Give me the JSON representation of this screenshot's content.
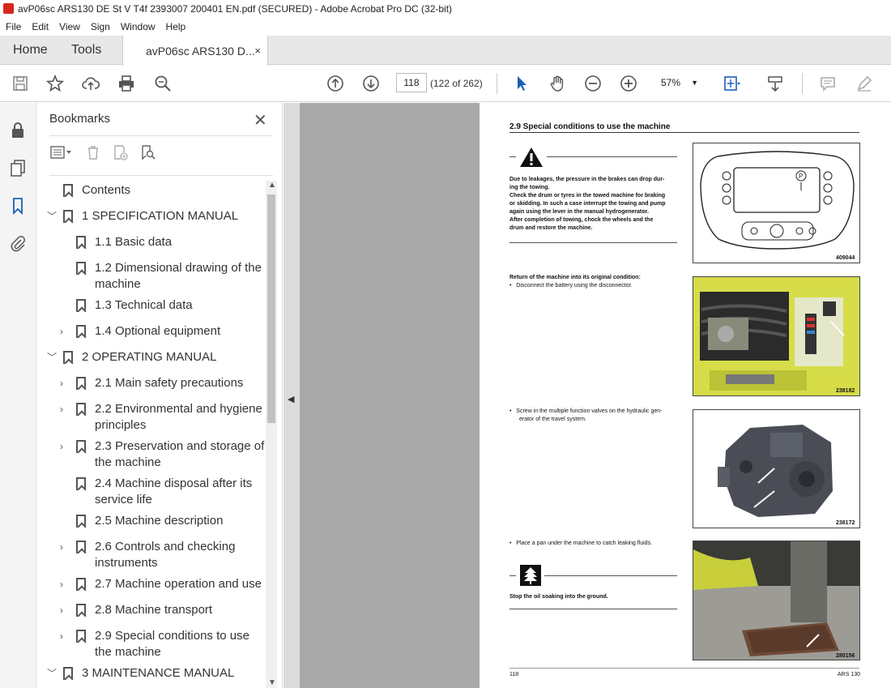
{
  "window": {
    "title": "avP06sc ARS130 DE St V T4f 2393007 200401 EN.pdf (SECURED) - Adobe Acrobat Pro DC (32-bit)"
  },
  "menu": [
    "File",
    "Edit",
    "View",
    "Sign",
    "Window",
    "Help"
  ],
  "tabs": {
    "home": "Home",
    "tools": "Tools",
    "doc": "avP06sc ARS130 D...",
    "close": "×"
  },
  "toolbar": {
    "page_current": "118",
    "page_count": "(122 of 262)",
    "zoom": "57%",
    "zoom_caret": "▼"
  },
  "bookmarks": {
    "title": "Bookmarks",
    "close": "✕",
    "items": [
      {
        "label": "Contents",
        "level": 0,
        "expand": false
      },
      {
        "label": "1 SPECIFICATION MANUAL",
        "level": 0,
        "expand": "open"
      },
      {
        "label": "1.1 Basic data",
        "level": 1,
        "expand": false
      },
      {
        "label": "1.2 Dimensional drawing of the",
        "label2": "machine",
        "level": 1,
        "expand": false
      },
      {
        "label": "1.3 Technical data",
        "level": 1,
        "expand": false
      },
      {
        "label": "1.4 Optional equipment",
        "level": 1,
        "expand": "closed"
      },
      {
        "label": "2 OPERATING MANUAL",
        "level": 0,
        "expand": "open"
      },
      {
        "label": "2.1 Main safety precautions",
        "level": 1,
        "expand": "closed"
      },
      {
        "label": "2.2 Environmental and hygiene",
        "label2": "principles",
        "level": 1,
        "expand": "closed"
      },
      {
        "label": "2.3 Preservation and storage of",
        "label2": "the machine",
        "level": 1,
        "expand": "closed"
      },
      {
        "label": "2.4 Machine disposal after its",
        "label2": "service life",
        "level": 1,
        "expand": false
      },
      {
        "label": "2.5 Machine description",
        "level": 1,
        "expand": false
      },
      {
        "label": "2.6 Controls and checking",
        "label2": "instruments",
        "level": 1,
        "expand": "closed"
      },
      {
        "label": "2.7 Machine operation and use",
        "level": 1,
        "expand": "closed"
      },
      {
        "label": "2.8 Machine transport",
        "level": 1,
        "expand": "closed"
      },
      {
        "label": "2.9 Special conditions to use",
        "label2": "the machine",
        "level": 1,
        "expand": "closed"
      },
      {
        "label": "3 MAINTENANCE MANUAL",
        "level": 0,
        "expand": "open"
      }
    ]
  },
  "page": {
    "heading": "2.9     Special conditions to use the machine",
    "warning_lines": [
      "Due to leakages, the pressure in the brakes can drop dur-",
      "ing the towing.",
      "Check the drum or tyres in the towed machine for braking",
      "or skidding. In such a case interrupt the towing and pump",
      "again using the lever in the manual hydrogenerator.",
      "After completion of towing, chock the wheels and the",
      "drum and restore the machine."
    ],
    "return_title": "Return of the machine into its original condition:",
    "bullet1": "Disconnect the battery using the disconnector.",
    "bullet2a": "Screw in the multiple function valves on the hydraulic gen-",
    "bullet2b": "erator of the travel system.",
    "bullet3": "Place a pan under the machine to catch leaking fluids.",
    "env_note": "Stop the oil soaking into the ground.",
    "fig1": "409044",
    "fig2": "238182",
    "fig3": "238172",
    "fig4": "280156",
    "footer_left": "118",
    "footer_right": "ARS 130"
  }
}
